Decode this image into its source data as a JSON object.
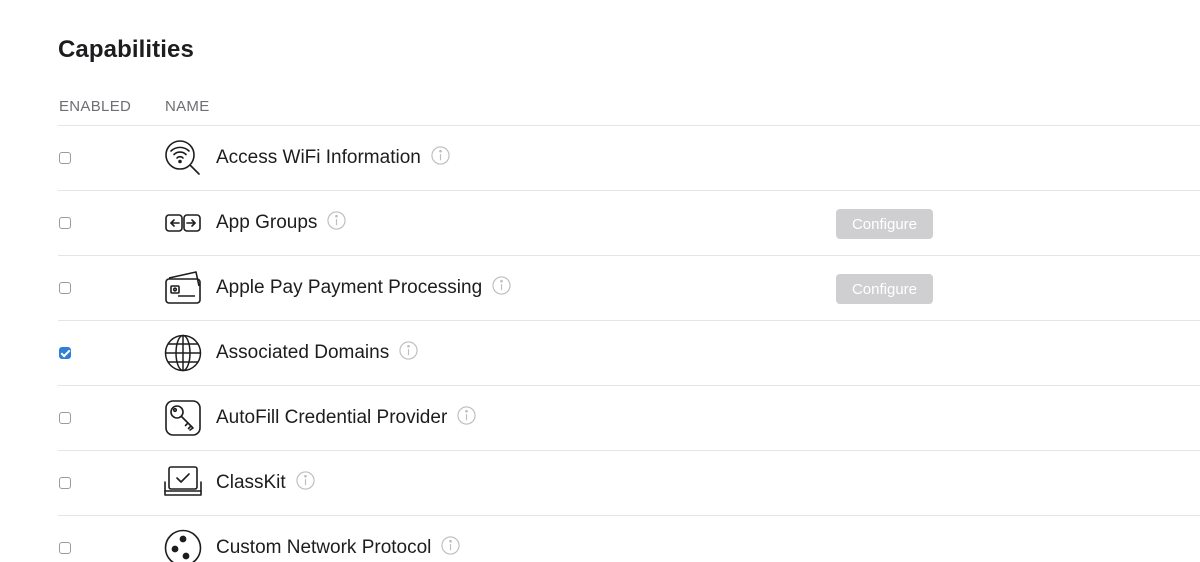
{
  "header": {
    "title": "Capabilities",
    "col_enabled": "ENABLED",
    "col_name": "NAME"
  },
  "capabilities": [
    {
      "name": "Access WiFi Information",
      "enabled": false,
      "icon": "wifi-search-icon",
      "configure_label": null
    },
    {
      "name": "App Groups",
      "enabled": false,
      "icon": "app-groups-icon",
      "configure_label": "Configure"
    },
    {
      "name": "Apple Pay Payment Processing",
      "enabled": false,
      "icon": "apple-pay-card-icon",
      "configure_label": "Configure"
    },
    {
      "name": "Associated Domains",
      "enabled": true,
      "icon": "globe-icon",
      "configure_label": null
    },
    {
      "name": "AutoFill Credential Provider",
      "enabled": false,
      "icon": "key-icon",
      "configure_label": null
    },
    {
      "name": "ClassKit",
      "enabled": false,
      "icon": "classkit-icon",
      "configure_label": null
    },
    {
      "name": "Custom Network Protocol",
      "enabled": false,
      "icon": "network-protocol-icon",
      "configure_label": null
    }
  ],
  "colors": {
    "checkbox_checked": "#2f7ed8",
    "configure_button_bg": "#cfcfd1",
    "divider": "#e5e5e7"
  }
}
